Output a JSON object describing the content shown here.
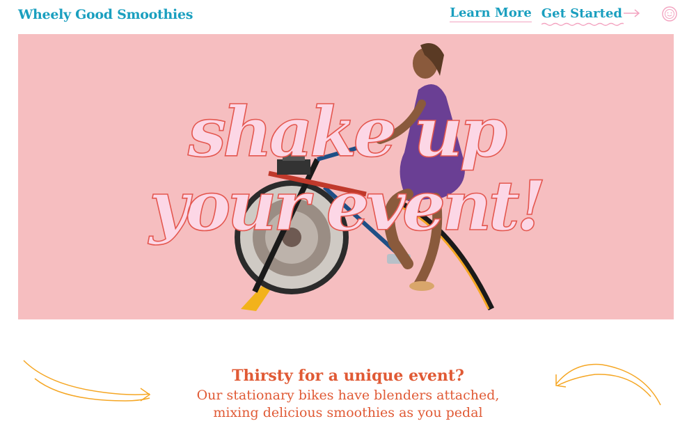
{
  "header": {
    "brand": "Wheely Good Smoothies",
    "nav": {
      "learn_more": "Learn More",
      "get_started": "Get Started"
    }
  },
  "hero": {
    "headline_line1": "shake up",
    "headline_line2": "your event!",
    "image_alt": "Woman riding a stationary blender bike"
  },
  "intro": {
    "heading": "Thirsty for a unique event?",
    "body_line1": "Our stationary bikes have blenders attached,",
    "body_line2": "mixing delicious smoothies as you pedal"
  },
  "colors": {
    "brand_teal": "#1a9fbf",
    "hero_pink": "#f6bec0",
    "headline_fill": "#fcd7e6",
    "accent_orange": "#e05a35",
    "deco_yellow": "#f5a623",
    "nav_pink": "#f3a3c0"
  },
  "icons": {
    "arrow": "arrow-right-icon",
    "smiley": "smiley-icon"
  }
}
